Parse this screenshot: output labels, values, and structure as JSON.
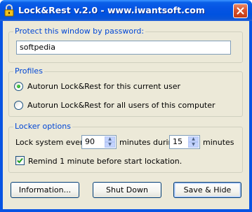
{
  "window": {
    "title": "Lock&Rest v.2.0 - www.iwantsoft.com"
  },
  "password_group": {
    "label": "Protect this window by password:",
    "password_value": "softpedia"
  },
  "profiles_group": {
    "label": "Profiles",
    "options": [
      {
        "label": "Autorun Lock&Rest for this current user",
        "selected": true
      },
      {
        "label": "Autorun Lock&Rest for all users of this computer",
        "selected": false
      }
    ]
  },
  "locker_group": {
    "label": "Locker options",
    "lock_every_label": "Lock system every",
    "lock_every_value": "90",
    "minutes_during_label": "minutes during",
    "during_value": "15",
    "minutes_label": "minutes",
    "remind_label": "Remind 1 minute before start lockation.",
    "remind_checked": true
  },
  "buttons": {
    "information": "Information...",
    "shut_down": "Shut Down",
    "save_hide": "Save & Hide"
  },
  "colors": {
    "title_bar": "#0554e3",
    "client_bg": "#ece9d8",
    "group_label": "#0046d5",
    "close_button": "#d8522c"
  }
}
